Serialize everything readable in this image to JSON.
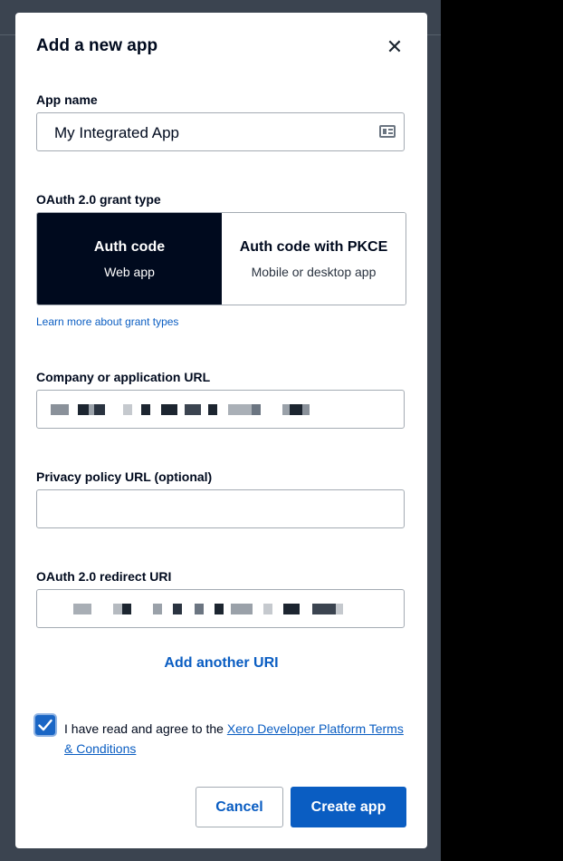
{
  "modal": {
    "title": "Add a new app",
    "close_icon": "close-icon"
  },
  "app_name": {
    "label": "App name",
    "value": "My Integrated App",
    "icon": "contact-card-icon"
  },
  "grant_type": {
    "label": "OAuth 2.0 grant type",
    "options": [
      {
        "title": "Auth code",
        "subtitle": "Web app",
        "selected": true
      },
      {
        "title": "Auth code with PKCE",
        "subtitle": "Mobile or desktop app",
        "selected": false
      }
    ],
    "learn_more": "Learn more about grant types"
  },
  "company_url": {
    "label": "Company or application URL",
    "value_redacted": true
  },
  "privacy_url": {
    "label": "Privacy policy URL (optional)",
    "value": ""
  },
  "redirect_uri": {
    "label": "OAuth 2.0 redirect URI",
    "value_redacted": true
  },
  "add_another_uri": "Add another URI",
  "terms": {
    "checked": true,
    "text": "I have read and agree to the ",
    "link": "Xero Developer Platform Terms & Conditions"
  },
  "actions": {
    "cancel": "Cancel",
    "create": "Create app"
  },
  "colors": {
    "accent": "#0a5dc2",
    "selected_segment": "#000a1e"
  }
}
